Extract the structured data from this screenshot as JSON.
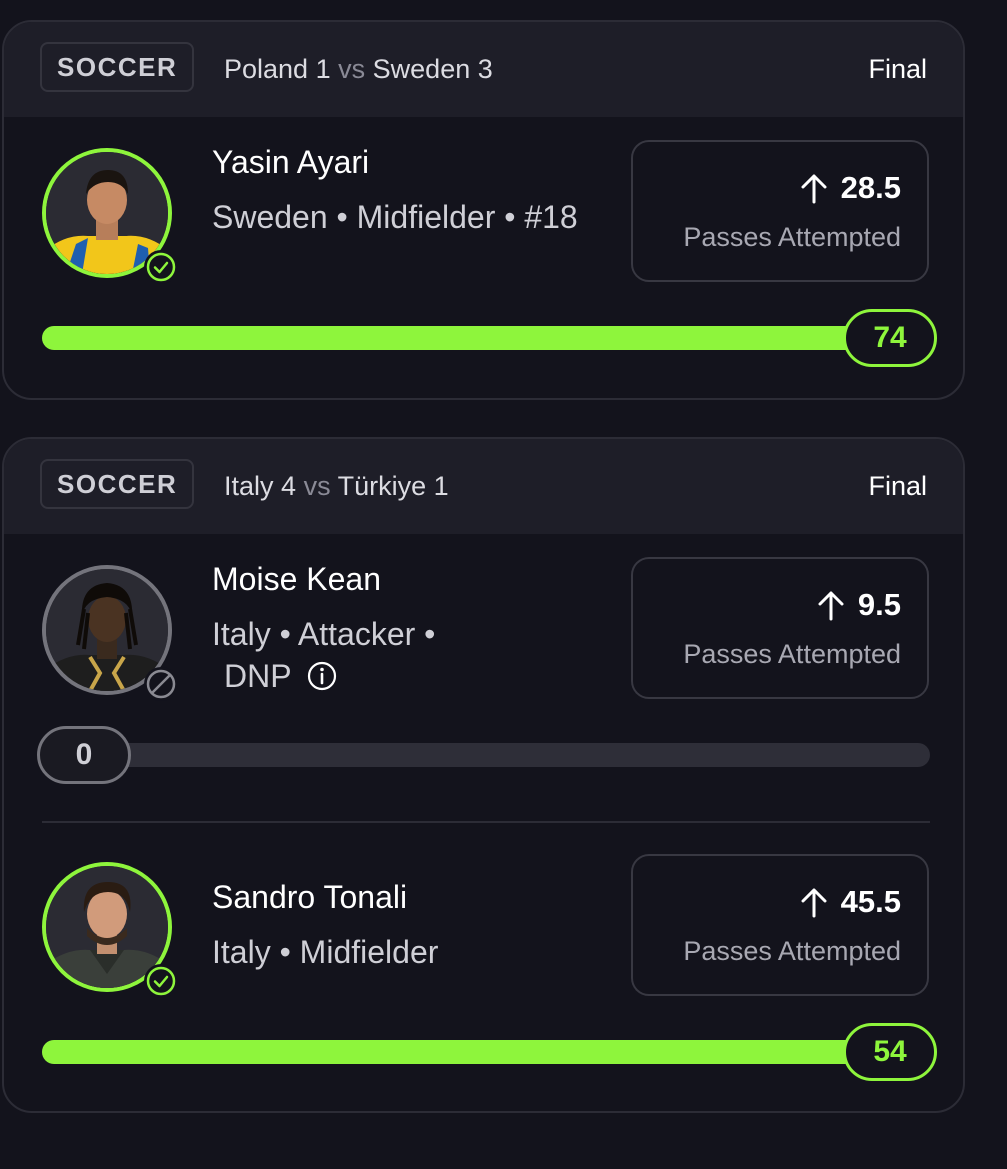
{
  "colors": {
    "accent": "#8ef53c",
    "background": "#13131c",
    "header": "#1e1e28",
    "muted": "#74747c"
  },
  "cards": [
    {
      "sport": "SOCCER",
      "home_team": "Poland",
      "home_score": "1",
      "vs": "vs",
      "away_team": "Sweden",
      "away_score": "3",
      "status": "Final",
      "players": [
        {
          "name": "Yasin Ayari",
          "meta": "Sweden • Midfielder • #18",
          "badge_icon": "check-circle-icon",
          "prop_direction_icon": "arrow-up-icon",
          "prop_line": "28.5",
          "prop_label": "Passes Attempted",
          "actual": "74",
          "progress_fraction": 1.0
        }
      ]
    },
    {
      "sport": "SOCCER",
      "home_team": "Italy",
      "home_score": "4",
      "vs": "vs",
      "away_team": "Türkiye",
      "away_score": "1",
      "status": "Final",
      "players": [
        {
          "name": "Moise Kean",
          "meta": "Italy • Attacker •",
          "meta_status": "DNP",
          "badge_icon": "block-icon",
          "info_icon": "info-icon",
          "prop_direction_icon": "arrow-up-icon",
          "prop_line": "9.5",
          "prop_label": "Passes Attempted",
          "actual": "0",
          "progress_fraction": 0.0
        },
        {
          "name": "Sandro Tonali",
          "meta": "Italy • Midfielder",
          "badge_icon": "check-circle-icon",
          "prop_direction_icon": "arrow-up-icon",
          "prop_line": "45.5",
          "prop_label": "Passes Attempted",
          "actual": "54",
          "progress_fraction": 1.0
        }
      ]
    }
  ]
}
